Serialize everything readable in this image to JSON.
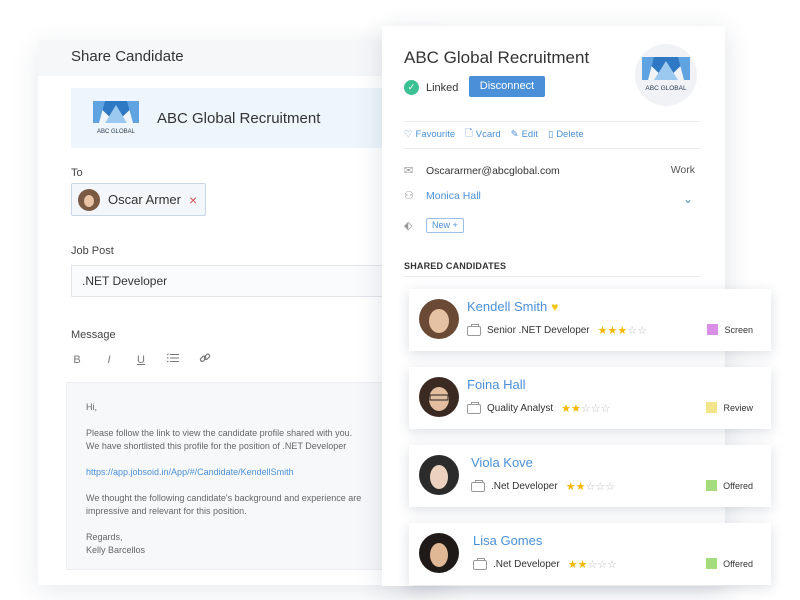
{
  "share": {
    "header": "Share Candidate",
    "company_name": "ABC Global Recruitment",
    "to_label": "To",
    "recipient": "Oscar Armer",
    "remove_symbol": "×",
    "job_post_label": "Job Post",
    "job_post_value": ".NET Developer",
    "message_label": "Message",
    "toolbar": [
      "B",
      "I",
      "U"
    ],
    "message": {
      "greeting": "Hi,",
      "line1": "Please follow the link to view the candidate profile shared with you.",
      "line2": "We have shortlisted this profile for the position of .NET Developer",
      "link": "https://app.jobsoid.in/App/#/Candidate/KendellSmith",
      "line3": "We thought the following candidate's background and experience are",
      "line4": "impressive and relevant for this position.",
      "regards": "Regards,",
      "signature": "Kelly Barcellos"
    }
  },
  "profile": {
    "title": "ABC Global Recruitment",
    "linked_label": "Linked",
    "disconnect_label": "Disconnect",
    "logo_text": "ABC GLOBAL",
    "actions": {
      "favourite": "Favourite",
      "vcard": "Vcard",
      "edit": "Edit",
      "delete": "Delete"
    },
    "email": "Oscararmer@abcglobal.com",
    "email_type": "Work",
    "owner": "Monica Hall",
    "tag": "New",
    "shared_title": "SHARED CANDIDATES"
  },
  "candidates": [
    {
      "name": "Kendell Smith",
      "role": "Senior .NET Developer",
      "rating": 3,
      "max_rating": 5,
      "status": "Screen",
      "status_color": "#d98fe6",
      "favourite": true
    },
    {
      "name": "Foina Hall",
      "role": "Quality Analyst",
      "rating": 2,
      "max_rating": 5,
      "status": "Review",
      "status_color": "#f5e58a",
      "favourite": false
    },
    {
      "name": "Viola Kove",
      "role": ".Net Developer",
      "rating": 2,
      "max_rating": 5,
      "status": "Offered",
      "status_color": "#a5dc7e",
      "favourite": false
    },
    {
      "name": "Lisa Gomes",
      "role": ".Net Developer",
      "rating": 2,
      "max_rating": 5,
      "status": "Offered",
      "status_color": "#a5dc7e",
      "favourite": false
    }
  ],
  "colors": {
    "accent": "#4a90d9",
    "linked_green": "#3cc195",
    "star": "#f5b700",
    "heart": "#f5c518",
    "remove_red": "#d9534f"
  }
}
